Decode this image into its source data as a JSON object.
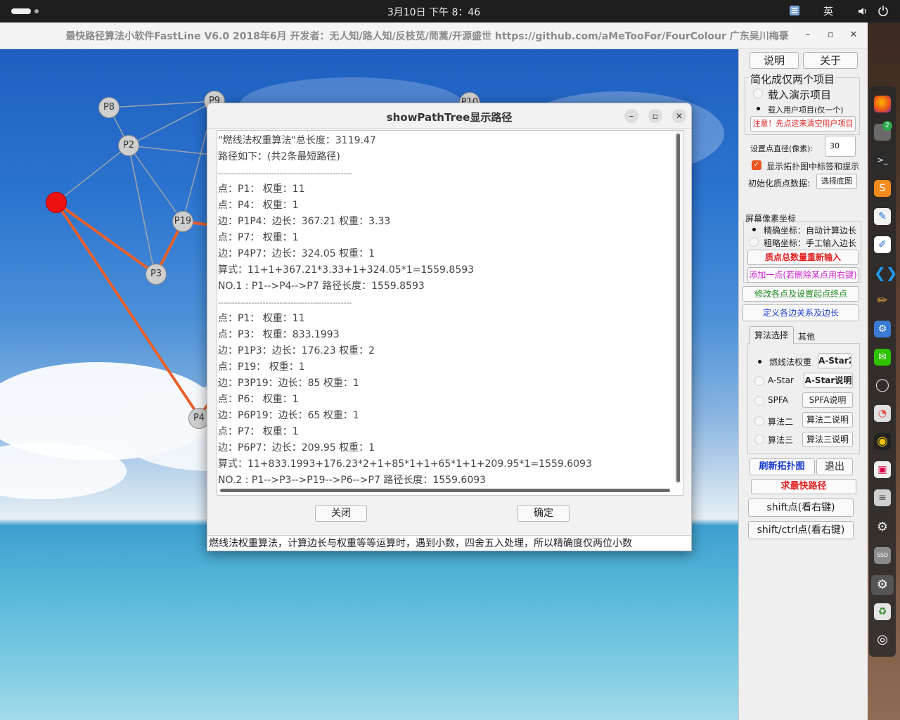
{
  "topbar": {
    "clock": "3月10日  下午 8：46",
    "ime": "英",
    "tray_icons": [
      "network-icon",
      "volume-icon",
      "power-icon"
    ]
  },
  "app": {
    "title": "最快路径算法小软件FastLine V6.0  2018年6月 开发者：无人知/路人知/反枝苋/茼蒿/开源盛世  https://github.com/aMeTooFor/FourColour 广东吴川梅菉",
    "win_min": "–",
    "win_max": "▫",
    "win_close": "✕"
  },
  "graph": {
    "nodes": [
      {
        "id": "p8",
        "label": "P8"
      },
      {
        "id": "p9",
        "label": "P9"
      },
      {
        "id": "p10",
        "label": "P10"
      },
      {
        "id": "p2",
        "label": "P2"
      },
      {
        "id": "p1",
        "label": ""
      },
      {
        "id": "p19",
        "label": "P19"
      },
      {
        "id": "p3",
        "label": "P3"
      },
      {
        "id": "p4",
        "label": "P4"
      }
    ],
    "highlight_color": "#e8602c",
    "start_color": "#ee1111"
  },
  "dialog": {
    "title": "showPathTree显示路径",
    "lines": [
      "\"燃线法权重算法\"总长度：3119.47",
      "路径如下：(共2条最短路径)",
      "------------------------------------------------",
      "点：P1：   权重：11",
      "点：P4：   权重：1",
      "边：P1P4：边长：367.21 权重：3.33",
      "点：P7：   权重：1",
      "边：P4P7：边长：324.05 权重：1",
      "算式：11+1+367.21*3.33+1+324.05*1=1559.8593",
      "NO.1 : P1-->P4-->P7  路径长度：1559.8593",
      "------------------------------------------------",
      "点：P1：   权重：11",
      "点：P3：   权重：833.1993",
      "边：P1P3：边长：176.23 权重：2",
      "点：P19：   权重：1",
      "边：P3P19：边长：85 权重：1",
      "点：P6：   权重：1",
      "边：P6P19：边长：65 权重：1",
      "点：P7：   权重：1",
      "边：P6P7：边长：209.95 权重：1",
      "算式：11+833.1993+176.23*2+1+85*1+1+65*1+1+209.95*1=1559.6093",
      "NO.2 : P1-->P3-->P19-->P6-->P7  路径长度：1559.6093"
    ],
    "close_btn": "关闭",
    "ok_btn": "确定",
    "status": "燃线法权重算法，计算边长与权重等等运算时，遇到小数，四舍五入处理，所以精确度仅两位小数",
    "btn_min": "–",
    "btn_max": "▫",
    "btn_close": "✕"
  },
  "panel": {
    "help": "说明",
    "about": "关于",
    "simplify_group": "简化成仅两个项目",
    "load_demo": "载入演示项目",
    "load_user": "载入用户项目(仅一个)",
    "warning": "注意！先点这来清空用户项目",
    "diameter_label": "设置点直径(像素):",
    "diameter_value": "30",
    "show_labels": "显示拓扑图中标签和提示",
    "init_label": "初始化质点数据:",
    "choose_bg": "选择底图",
    "coord_group": "屏幕像素坐标",
    "precise": "精确坐标：自动计算边长",
    "rough": "粗略坐标：手工输入边长",
    "reinput": "质点总数量重新输入",
    "add_point": "添加一点(若删除某点用右键)",
    "modify": "修改各点及设置起点终点",
    "define_edges": "定义各边关系及边长",
    "tab_algo": "算法选择",
    "tab_other": "其他",
    "algos": [
      {
        "name": "燃线法权重",
        "btn": "A-Star2",
        "selected": true
      },
      {
        "name": "A-Star",
        "btn": "A-Star说明",
        "selected": false
      },
      {
        "name": "SPFA",
        "btn": "SPFA说明",
        "selected": false
      },
      {
        "name": "算法二",
        "btn": "算法二说明",
        "selected": false
      },
      {
        "name": "算法三",
        "btn": "算法三说明",
        "selected": false
      }
    ],
    "refresh": "刷新拓扑图",
    "exit": "退出",
    "find_path": "求最快路径",
    "shift_point": "shift点(看右键)",
    "shift_ctrl_point": "shift/ctrl点(看右键)",
    "colors": {
      "red": "#e02020",
      "green": "#1a8a1a",
      "blue": "#1a3ccc",
      "magenta": "#d020d0"
    }
  },
  "dock": {
    "icons": [
      "firefox-icon",
      "files-icon",
      "terminal-icon",
      "sublime-icon",
      "text-editor-icon",
      "notes-icon",
      "vscode-icon",
      "paint-icon",
      "settings-gear-icon",
      "wechat-icon",
      "chat-icon",
      "disk-usage-icon",
      "music-icon",
      "software-icon",
      "database-icon",
      "system-settings-icon",
      "ssd-icon",
      "settings-icon",
      "trash-icon",
      "ubuntu-icon"
    ],
    "files_badge": "2"
  }
}
